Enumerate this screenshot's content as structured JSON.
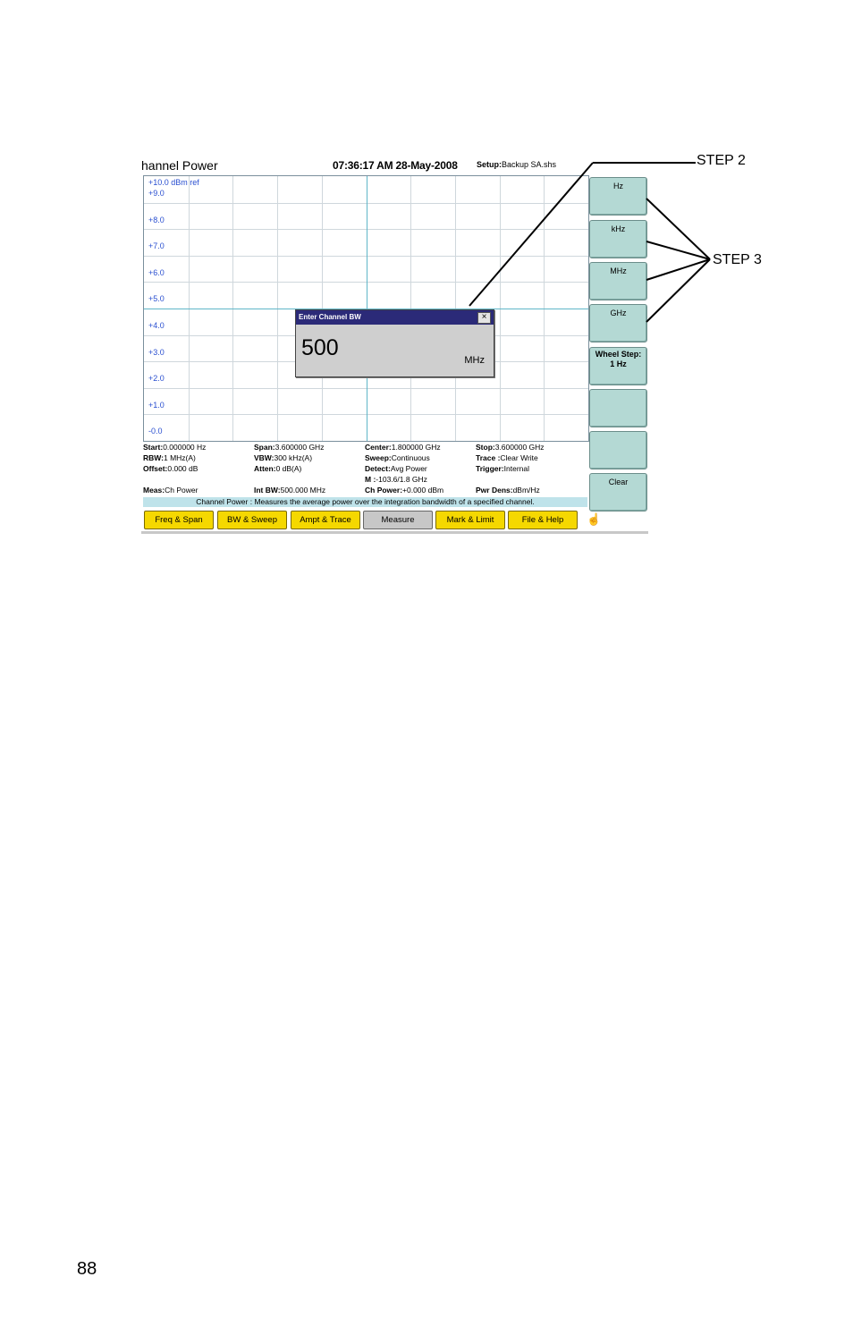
{
  "screen": {
    "title": "hannel Power",
    "clock": "07:36:17 AM 28-May-2008",
    "setup_label": "Setup:",
    "setup_value": "Backup SA.shs"
  },
  "graph": {
    "ref_label": "+10.0 dBm ref",
    "y_labels": [
      "+9.0",
      "+8.0",
      "+7.0",
      "+6.0",
      "+5.0",
      "+4.0",
      "+3.0",
      "+2.0",
      "+1.0",
      "-0.0"
    ]
  },
  "dialog": {
    "title": "Enter Channel BW",
    "close": "×",
    "value": "500",
    "unit": "MHz"
  },
  "softkeys": [
    "Hz",
    "kHz",
    "MHz",
    "GHz",
    "Wheel Step:",
    "1 Hz",
    "",
    "",
    "Clear"
  ],
  "status": {
    "rows": [
      [
        [
          "Start:",
          "0.000000 Hz"
        ],
        [
          "Span:",
          "3.600000 GHz"
        ],
        [
          "Center:",
          "1.800000 GHz"
        ],
        [
          "Stop:",
          "3.600000 GHz"
        ]
      ],
      [
        [
          "RBW:",
          "1 MHz(A)"
        ],
        [
          "VBW:",
          "300 kHz(A)"
        ],
        [
          "Sweep:",
          "Continuous"
        ],
        [
          "Trace :",
          "Clear Write"
        ]
      ],
      [
        [
          "Offset:",
          "0.000 dB"
        ],
        [
          "Atten:",
          "0 dB(A)"
        ],
        [
          "Detect:",
          "Avg Power"
        ],
        [
          "Trigger:",
          "Internal"
        ]
      ],
      [
        [
          "",
          ""
        ],
        [
          "",
          ""
        ],
        [
          "M :",
          "-103.6/1.8 GHz"
        ],
        [
          "",
          ""
        ]
      ],
      [
        [
          "Meas:",
          "Ch Power"
        ],
        [
          "Int BW:",
          "500.000 MHz"
        ],
        [
          "Ch Power:",
          "+0.000 dBm"
        ],
        [
          "Pwr Dens:",
          "dBm/Hz"
        ]
      ]
    ]
  },
  "help_text": "Channel Power : Measures the average power over the integration bandwidth of a specified channel.",
  "tabs": [
    "Freq & Span",
    "BW & Sweep",
    "Ampt & Trace",
    "Measure",
    "Mark & Limit",
    "File & Help"
  ],
  "active_tab": "Measure",
  "callouts": {
    "step2": "STEP 2",
    "step3": "STEP 3"
  },
  "page_number": "88"
}
